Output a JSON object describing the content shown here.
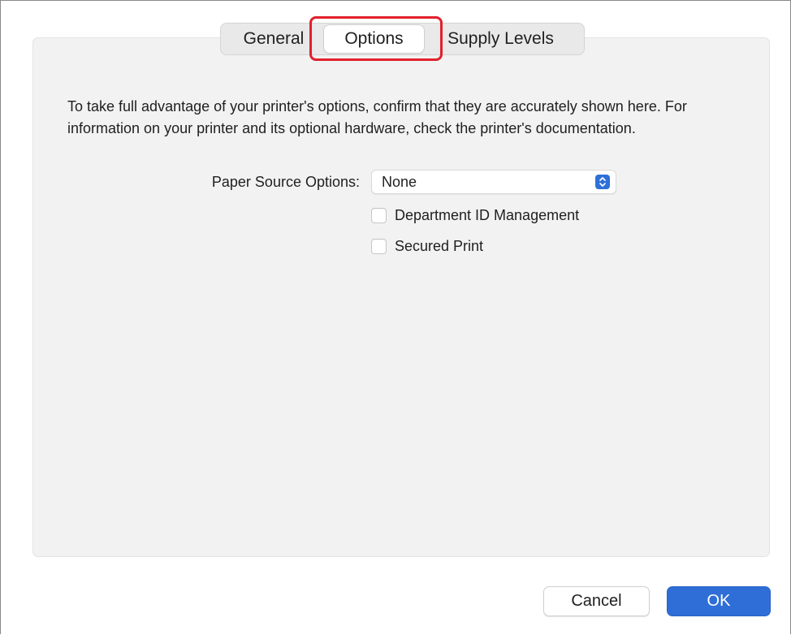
{
  "tabs": {
    "general": "General",
    "options": "Options",
    "supply_levels": "Supply Levels",
    "selected": "Options"
  },
  "description": "To take full advantage of your printer's options, confirm that they are accurately shown here. For information on your printer and its optional hardware, check the printer's documentation.",
  "paper_source": {
    "label": "Paper Source Options:",
    "value": "None"
  },
  "checkboxes": [
    {
      "label": "Department ID Management",
      "checked": false
    },
    {
      "label": "Secured Print",
      "checked": false
    }
  ],
  "buttons": {
    "cancel": "Cancel",
    "ok": "OK"
  },
  "colors": {
    "accent": "#2f6ed6",
    "highlight": "#e2202c",
    "panel": "#f2f2f2"
  }
}
